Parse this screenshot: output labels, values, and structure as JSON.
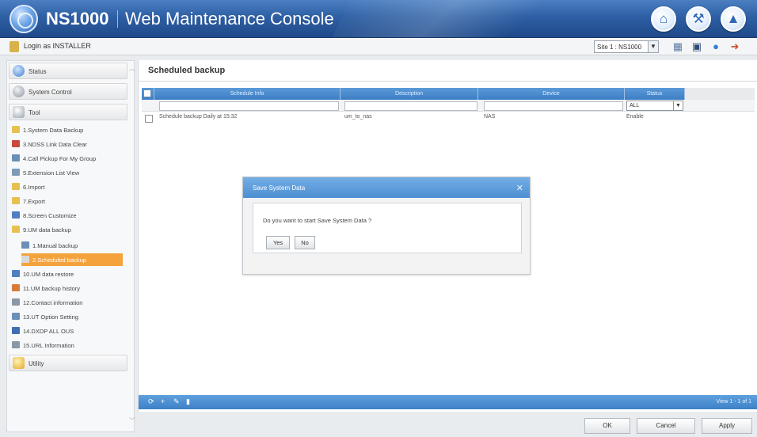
{
  "header": {
    "product": "NS1000",
    "console_title": "Web Maintenance Console",
    "buttons": [
      "home-icon",
      "tools-icon",
      "alert-icon"
    ]
  },
  "subbar": {
    "login_text": "Login as INSTALLER",
    "site_selector_value": "Site 1 : NS1000",
    "toolbar_icons": [
      "monitor-icon",
      "save-icon",
      "info-icon",
      "logout-icon"
    ]
  },
  "sidebar": {
    "sections": {
      "status": "Status",
      "system_control": "System Control",
      "tool": "Tool",
      "utility": "Utility"
    },
    "items": [
      {
        "label": "1.System Data Backup",
        "icon_color": "#e8c050"
      },
      {
        "label": "3.NDSS Link Data Clear",
        "icon_color": "#c94a3b"
      },
      {
        "label": "4.Call Pickup For My Group",
        "icon_color": "#6c8fb8"
      },
      {
        "label": "5.Extension List View",
        "icon_color": "#7f9bb8"
      },
      {
        "label": "6.Import",
        "icon_color": "#e8c050"
      },
      {
        "label": "7.Export",
        "icon_color": "#e8c050"
      },
      {
        "label": "8.Screen Customize",
        "icon_color": "#4f7fc0"
      },
      {
        "label": "9.UM data backup",
        "icon_color": "#e8c050"
      }
    ],
    "subitems": [
      {
        "label": "1.Manual backup",
        "icon_color": "#6c8fb8"
      },
      {
        "label": "2.Scheduled backup",
        "icon_color": "#d9d9d9"
      }
    ],
    "items_after": [
      {
        "label": "10.UM data restore",
        "icon_color": "#4f7fc0"
      },
      {
        "label": "11.UM backup history",
        "icon_color": "#d87a3a"
      },
      {
        "label": "12.Contact information",
        "icon_color": "#8b98a5"
      },
      {
        "label": "13.UT Option Setting",
        "icon_color": "#6c8fb8"
      },
      {
        "label": "14.DXDP ALL OUS",
        "icon_color": "#3f6fb0"
      },
      {
        "label": "15.URL Information",
        "icon_color": "#8b98a5"
      }
    ]
  },
  "main": {
    "title": "Scheduled backup",
    "columns": [
      "Schedule Info",
      "Description",
      "Device",
      "Status"
    ],
    "status_filter": "ALL",
    "rows": [
      {
        "schedule": "Schedule backup Daily at 15:32",
        "description": "um_to_nas",
        "device": "NAS",
        "status": "Enable"
      }
    ],
    "view_count": "View 1 - 1 of 1"
  },
  "dialog": {
    "title": "Save System Data",
    "message": "Do you want to start Save System Data ?",
    "yes_label": "Yes",
    "no_label": "No"
  },
  "bottom_buttons": {
    "ok": "OK",
    "cancel": "Cancel",
    "apply": "Apply"
  },
  "colors": {
    "header_blue": "#2e5fa4",
    "active_item": "#f4a23b",
    "grid_header": "#3c7ec4"
  }
}
